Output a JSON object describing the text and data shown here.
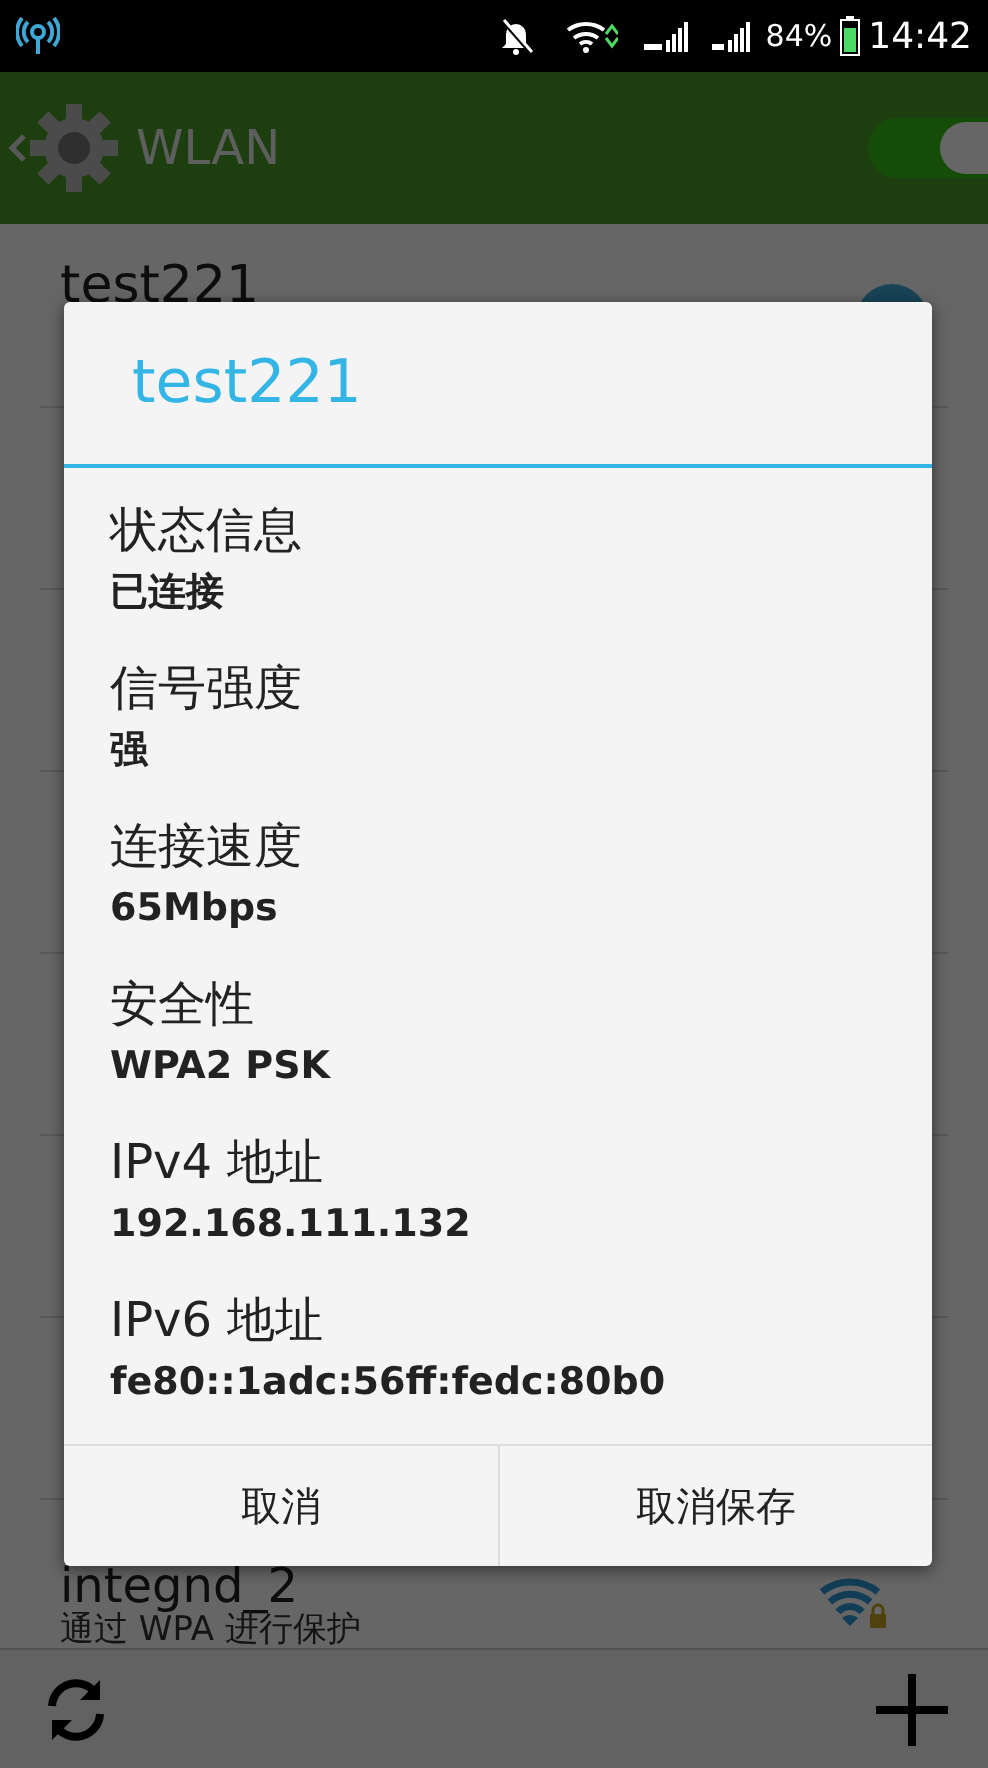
{
  "status_bar": {
    "battery": "84%",
    "time": "14:42"
  },
  "header": {
    "title": "WLAN",
    "switch_on": true
  },
  "networks": [
    {
      "name": "test221"
    },
    {
      "name": "integnd_2",
      "subtitle": "通过 WPA 进行保护"
    }
  ],
  "dialog": {
    "title": "test221",
    "fields": [
      {
        "label": "状态信息",
        "value": "已连接"
      },
      {
        "label": "信号强度",
        "value": "强"
      },
      {
        "label": "连接速度",
        "value": "65Mbps"
      },
      {
        "label": "安全性",
        "value": "WPA2 PSK"
      },
      {
        "label": "IPv4 地址",
        "value": "192.168.111.132"
      },
      {
        "label": "IPv6 地址",
        "value": "fe80::1adc:56ff:fedc:80b0"
      }
    ],
    "buttons": [
      "取消",
      "取消保存"
    ]
  }
}
